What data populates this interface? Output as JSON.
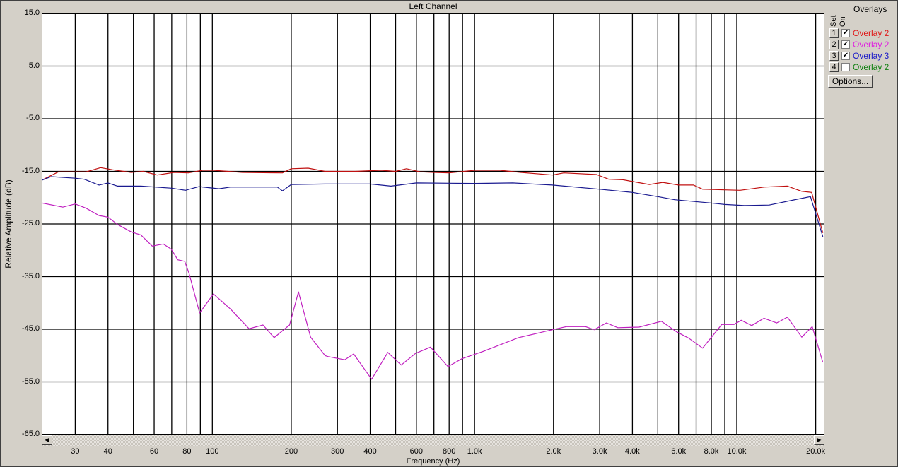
{
  "chart_data": {
    "type": "line",
    "title": "Left Channel",
    "xlabel": "Frequency (Hz)",
    "ylabel": "Relative Amplitude (dB)",
    "xscale": "log",
    "xlim": [
      22.35,
      21600
    ],
    "ylim": [
      -65,
      15
    ],
    "grid": true,
    "ytick_labels": [
      "15.0",
      "5.0",
      "-5.0",
      "-15.0",
      "-25.0",
      "-35.0",
      "-45.0",
      "-55.0",
      "-65.0"
    ],
    "yticks": [
      15,
      5,
      -5,
      -15,
      -25,
      -35,
      -45,
      -55,
      -65
    ],
    "xgrid": [
      30,
      40,
      50,
      60,
      70,
      80,
      90,
      100,
      200,
      300,
      400,
      500,
      600,
      700,
      800,
      900,
      1000,
      2000,
      3000,
      4000,
      5000,
      6000,
      7000,
      8000,
      9000,
      10000,
      20000
    ],
    "xticks": [
      30,
      40,
      60,
      80,
      100,
      200,
      300,
      400,
      600,
      800,
      1000,
      2000,
      3000,
      4000,
      6000,
      8000,
      10000,
      20000
    ],
    "xtick_labels": [
      "30",
      "40",
      "60",
      "80",
      "100",
      "200",
      "300",
      "400",
      "600",
      "800",
      "1.0k",
      "2.0k",
      "3.0k",
      "4.0k",
      "6.0k",
      "8.0k",
      "10.0k",
      "20.0k"
    ],
    "series": [
      {
        "name": "Overlay 2",
        "color": "#c01010",
        "points": [
          [
            22.3,
            -16.7
          ],
          [
            25.9,
            -15.1
          ],
          [
            33,
            -15.1
          ],
          [
            37.5,
            -14.3
          ],
          [
            41.7,
            -14.7
          ],
          [
            49,
            -15.2
          ],
          [
            54.5,
            -15
          ],
          [
            61.6,
            -15.7
          ],
          [
            71.5,
            -15.2
          ],
          [
            81,
            -15.3
          ],
          [
            91.6,
            -14.8
          ],
          [
            101,
            -14.8
          ],
          [
            130,
            -15.2
          ],
          [
            185,
            -15.3
          ],
          [
            200,
            -14.5
          ],
          [
            232,
            -14.4
          ],
          [
            269,
            -15
          ],
          [
            350,
            -15
          ],
          [
            440,
            -14.8
          ],
          [
            500,
            -15
          ],
          [
            550,
            -14.5
          ],
          [
            620,
            -15.1
          ],
          [
            700,
            -15.2
          ],
          [
            800,
            -15.3
          ],
          [
            1000,
            -14.8
          ],
          [
            1250,
            -14.8
          ],
          [
            1500,
            -15.2
          ],
          [
            1980,
            -15.7
          ],
          [
            2190,
            -15.3
          ],
          [
            2920,
            -15.6
          ],
          [
            3250,
            -16.5
          ],
          [
            3680,
            -16.6
          ],
          [
            4640,
            -17.5
          ],
          [
            5220,
            -17.1
          ],
          [
            6000,
            -17.6
          ],
          [
            6840,
            -17.6
          ],
          [
            7410,
            -18.4
          ],
          [
            10300,
            -18.6
          ],
          [
            12700,
            -18
          ],
          [
            15600,
            -17.8
          ],
          [
            17700,
            -18.8
          ],
          [
            19300,
            -19
          ],
          [
            21300,
            -26.7
          ]
        ]
      },
      {
        "name": "Overlay 2",
        "color": "#c020c0",
        "points": [
          [
            22.3,
            -21
          ],
          [
            26.9,
            -21.8
          ],
          [
            30,
            -21.2
          ],
          [
            33,
            -22
          ],
          [
            37,
            -23.4
          ],
          [
            40,
            -23.7
          ],
          [
            43.5,
            -25.1
          ],
          [
            49,
            -26.5
          ],
          [
            53.4,
            -27.1
          ],
          [
            59,
            -29.2
          ],
          [
            65,
            -28.8
          ],
          [
            69.8,
            -29.8
          ],
          [
            73.8,
            -31.8
          ],
          [
            78.5,
            -32.1
          ],
          [
            81.5,
            -34.4
          ],
          [
            89.4,
            -41.9
          ],
          [
            101,
            -38.3
          ],
          [
            117.5,
            -41.2
          ],
          [
            138,
            -44.9
          ],
          [
            156,
            -44.2
          ],
          [
            172,
            -46.6
          ],
          [
            197,
            -44.2
          ],
          [
            213,
            -37.9
          ],
          [
            237,
            -46.5
          ],
          [
            269,
            -50
          ],
          [
            276,
            -50.2
          ],
          [
            320,
            -50.8
          ],
          [
            346,
            -49.7
          ],
          [
            405,
            -54.5
          ],
          [
            467,
            -49.4
          ],
          [
            525,
            -51.8
          ],
          [
            595,
            -49.6
          ],
          [
            679,
            -48.4
          ],
          [
            792,
            -52.1
          ],
          [
            895,
            -50.6
          ],
          [
            1080,
            -49.2
          ],
          [
            1470,
            -46.6
          ],
          [
            1980,
            -45.1
          ],
          [
            2240,
            -44.5
          ],
          [
            2650,
            -44.5
          ],
          [
            2860,
            -45.1
          ],
          [
            3180,
            -43.8
          ],
          [
            3520,
            -44.7
          ],
          [
            4240,
            -44.6
          ],
          [
            5160,
            -43.5
          ],
          [
            5900,
            -45.5
          ],
          [
            6560,
            -46.7
          ],
          [
            7410,
            -48.6
          ],
          [
            8760,
            -44.1
          ],
          [
            9750,
            -44.1
          ],
          [
            10400,
            -43.3
          ],
          [
            11400,
            -44.3
          ],
          [
            12700,
            -42.9
          ],
          [
            14200,
            -43.8
          ],
          [
            15600,
            -42.7
          ],
          [
            17700,
            -46.5
          ],
          [
            19400,
            -44.5
          ],
          [
            21300,
            -51.3
          ]
        ]
      },
      {
        "name": "Overlay 3",
        "color": "#1a1a90",
        "points": [
          [
            22.3,
            -16.7
          ],
          [
            24.3,
            -16
          ],
          [
            30,
            -16.3
          ],
          [
            32.5,
            -16.5
          ],
          [
            37,
            -17.6
          ],
          [
            40,
            -17.2
          ],
          [
            43.5,
            -17.8
          ],
          [
            53.4,
            -17.8
          ],
          [
            70,
            -18.2
          ],
          [
            79,
            -18.6
          ],
          [
            89,
            -17.9
          ],
          [
            106,
            -18.3
          ],
          [
            117,
            -18
          ],
          [
            177,
            -18
          ],
          [
            185,
            -18.7
          ],
          [
            200,
            -17.5
          ],
          [
            269,
            -17.4
          ],
          [
            400,
            -17.4
          ],
          [
            480,
            -17.8
          ],
          [
            600,
            -17.2
          ],
          [
            1000,
            -17.3
          ],
          [
            1400,
            -17.2
          ],
          [
            1980,
            -17.6
          ],
          [
            3000,
            -18.4
          ],
          [
            4000,
            -19
          ],
          [
            5000,
            -19.8
          ],
          [
            5800,
            -20.4
          ],
          [
            7900,
            -21
          ],
          [
            9000,
            -21.3
          ],
          [
            10700,
            -21.5
          ],
          [
            13300,
            -21.4
          ],
          [
            17000,
            -20.3
          ],
          [
            19100,
            -19.8
          ],
          [
            21300,
            -27.4
          ]
        ]
      }
    ]
  },
  "overlays": {
    "title": "Overlays",
    "set_label": "Set",
    "on_label": "On",
    "items": [
      {
        "set": "1",
        "name": "Overlay 2",
        "checked": true,
        "color": "#e01818"
      },
      {
        "set": "2",
        "name": "Overlay 2",
        "checked": true,
        "color": "#e020e0"
      },
      {
        "set": "3",
        "name": "Overlay 3",
        "checked": true,
        "color": "#1818c8"
      },
      {
        "set": "4",
        "name": "Overlay 2",
        "checked": false,
        "color": "#108010"
      }
    ],
    "options_label": "Options...",
    "check_glyph": "✔"
  },
  "scroll": {
    "left": "◀",
    "right": "▶"
  }
}
